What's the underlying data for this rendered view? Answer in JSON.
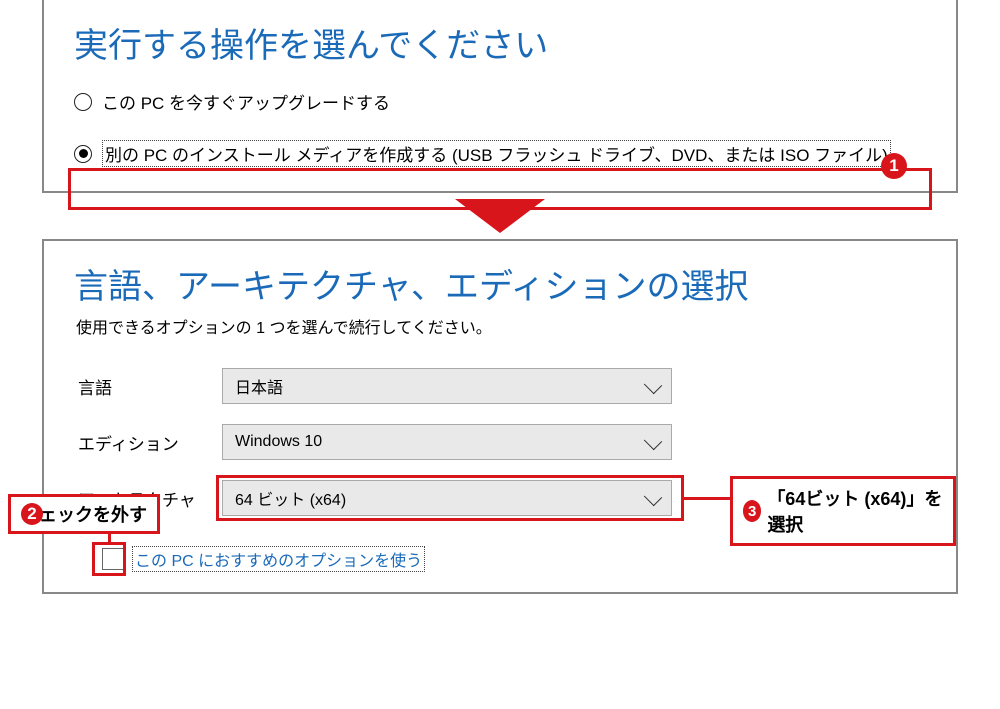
{
  "panel1": {
    "heading": "実行する操作を選んでください",
    "option_upgrade": "この PC を今すぐアップグレードする",
    "option_media": "別の PC のインストール メディアを作成する (USB フラッシュ ドライブ、DVD、または ISO ファイル)"
  },
  "panel2": {
    "heading": "言語、アーキテクチャ、エディションの選択",
    "sub": "使用できるオプションの 1 つを選んで続行してください。",
    "label_language": "言語",
    "value_language": "日本語",
    "label_edition": "エディション",
    "value_edition": "Windows 10",
    "label_arch": "アーキテクチャ",
    "value_arch": "64 ビット (x64)",
    "checkbox_label": "この PC におすすめのオプションを使う"
  },
  "annotations": {
    "badge1": "1",
    "badge2": "2",
    "badge3": "3",
    "note2": "チェックを外す",
    "note3": "「64ビット (x64)」を選択"
  }
}
